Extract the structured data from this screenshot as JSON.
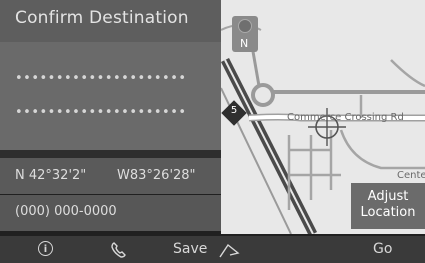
{
  "header": {
    "title": "Confirm Destination"
  },
  "address": {
    "line1": "•••••••••••••••••••••",
    "line2": "•••••••••••••••••••••"
  },
  "coordinates": {
    "latitude": "N 42°32'2\"",
    "longitude": "W83°26'28\""
  },
  "phone": "(000) 000-0000",
  "map": {
    "compass_label": "N",
    "street_label": "Commerce Crossing Rd",
    "center_label": "Center",
    "route_number": "5",
    "adjust_button": {
      "line1": "Adjust",
      "line2": "Location"
    }
  },
  "bottom_bar": {
    "info_label": "i",
    "save_label": "Save",
    "go_label": "Go"
  }
}
